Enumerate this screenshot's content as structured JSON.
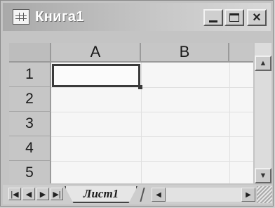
{
  "window": {
    "title": "Книга1",
    "icons": {
      "app": "spreadsheet-icon",
      "minimize": "minimize-icon",
      "maximize": "maximize-icon",
      "close": "close-icon"
    },
    "close_glyph": "×"
  },
  "grid": {
    "columns": [
      "A",
      "B",
      ""
    ],
    "rows": [
      "1",
      "2",
      "3",
      "4",
      "5"
    ],
    "active_cell": "A1"
  },
  "sheet_tabs": {
    "active": "Лист1",
    "nav_glyphs": [
      "|◀",
      "◀",
      "▶",
      "▶|"
    ]
  },
  "scroll": {
    "up_glyph": "▲",
    "down_glyph": "▼",
    "left_glyph": "◀",
    "right_glyph": "▶"
  }
}
